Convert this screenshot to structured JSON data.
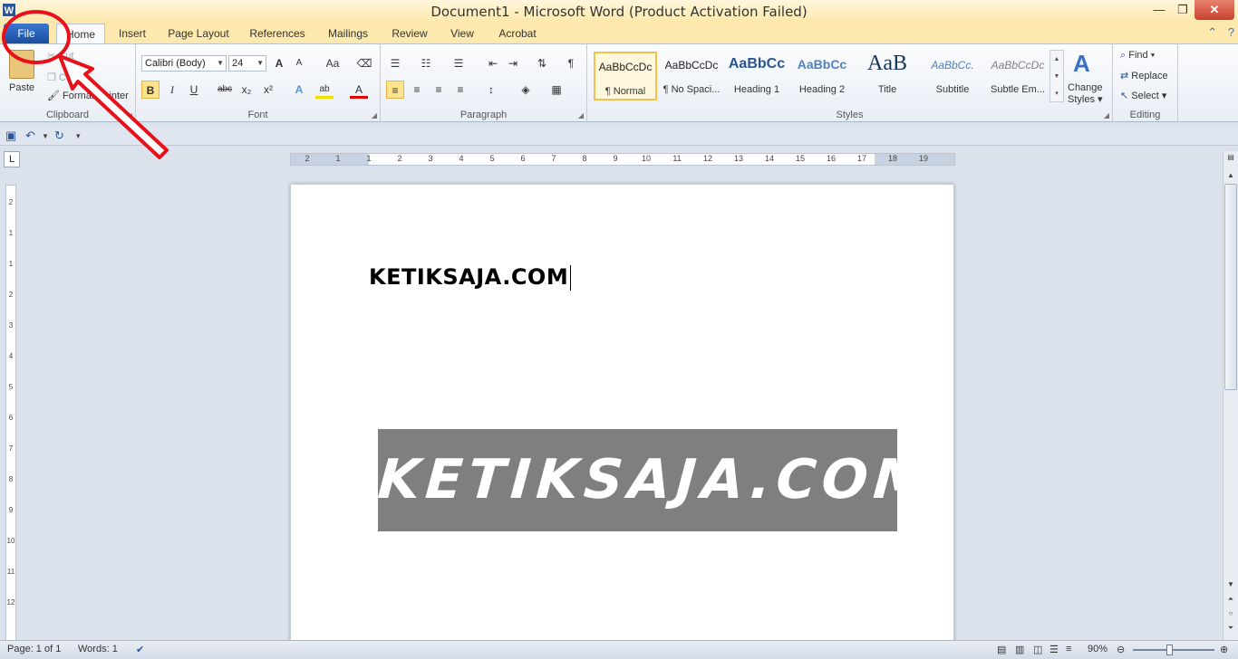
{
  "window": {
    "title": "Document1  -  Microsoft Word (Product Activation Failed)",
    "app_icon_letter": "W",
    "minimize": "—",
    "restore": "❐",
    "close": "✕"
  },
  "tabs": [
    "File",
    "Home",
    "Insert",
    "Page Layout",
    "References",
    "Mailings",
    "Review",
    "View",
    "Acrobat"
  ],
  "ribbon": {
    "clipboard": {
      "label": "Clipboard",
      "paste": "Paste",
      "cut": "Cut",
      "copy": "Copy",
      "format_painter": "Format Painter"
    },
    "font": {
      "label": "Font",
      "font_name": "Calibri (Body)",
      "font_size": "24",
      "bold": "B",
      "italic": "I",
      "underline": "U",
      "strikethrough": "abc",
      "subscript": "x₂",
      "superscript": "x²",
      "grow": "A",
      "shrink": "A",
      "change_case": "Aa",
      "text_effects": "A",
      "highlight": "ab",
      "font_color": "A"
    },
    "paragraph": {
      "label": "Paragraph",
      "pilcrow": "¶"
    },
    "styles": {
      "label": "Styles",
      "items": [
        {
          "preview": "AaBbCcDc",
          "name": "¶ Normal"
        },
        {
          "preview": "AaBbCcDc",
          "name": "¶ No Spaci..."
        },
        {
          "preview": "AaBbCc",
          "name": "Heading 1"
        },
        {
          "preview": "AaBbCc",
          "name": "Heading 2"
        },
        {
          "preview": "AaB",
          "name": "Title"
        },
        {
          "preview": "AaBbCc.",
          "name": "Subtitle"
        },
        {
          "preview": "AaBbCcDc",
          "name": "Subtle Em..."
        }
      ],
      "change_styles_line1": "Change",
      "change_styles_line2": "Styles ▾"
    },
    "editing": {
      "label": "Editing",
      "find": "Find ▾",
      "replace": "Replace",
      "select": "Select ▾"
    }
  },
  "ruler": {
    "h_ticks": [
      "2",
      "1",
      "1",
      "2",
      "3",
      "4",
      "5",
      "6",
      "7",
      "8",
      "9",
      "10",
      "11",
      "12",
      "13",
      "14",
      "15",
      "16",
      "17",
      "18",
      "19"
    ],
    "v_ticks": [
      "2",
      "1",
      "1",
      "2",
      "3",
      "4",
      "5",
      "6",
      "7",
      "8",
      "9",
      "10",
      "11",
      "12"
    ]
  },
  "document": {
    "text": "KETIKSAJA.COM",
    "banner_text": "KETIKSAJA.COM"
  },
  "statusbar": {
    "page": "Page: 1 of 1",
    "words": "Words: 1",
    "zoom": "90%"
  },
  "colors": {
    "file_tab": "#2b5ca8",
    "annotation": "#e8101a",
    "banner_bg": "#7f7f7f"
  }
}
